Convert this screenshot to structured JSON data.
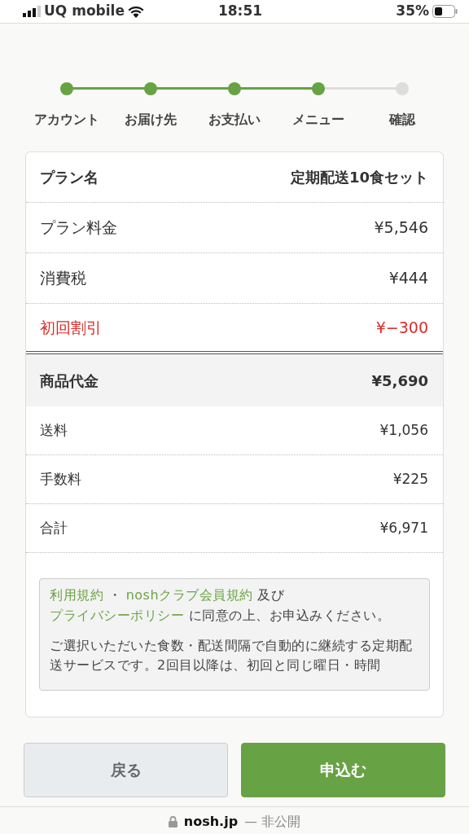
{
  "status_bar": {
    "carrier": "UQ mobile",
    "time": "18:51",
    "battery": "35%"
  },
  "steps": [
    {
      "label": "アカウント",
      "done": true
    },
    {
      "label": "お届け先",
      "done": true
    },
    {
      "label": "お支払い",
      "done": true
    },
    {
      "label": "メニュー",
      "done": true
    },
    {
      "label": "確認",
      "done": false
    }
  ],
  "summary": [
    {
      "kind": "header",
      "label": "プラン名",
      "value": "定期配送10食セット"
    },
    {
      "kind": "item",
      "label": "プラン料金",
      "value": "¥5,546"
    },
    {
      "kind": "item",
      "label": "消費税",
      "value": "¥444"
    },
    {
      "kind": "discount",
      "label": "初回割引",
      "value": "¥−300"
    },
    {
      "kind": "subtotal",
      "label": "商品代金",
      "value": "¥5,690"
    },
    {
      "kind": "small",
      "label": "送料",
      "value": "¥1,056"
    },
    {
      "kind": "small",
      "label": "手数料",
      "value": "¥225"
    },
    {
      "kind": "small",
      "label": "合計",
      "value": "¥6,971"
    }
  ],
  "agreement": {
    "parts": [
      {
        "text": "利用規約",
        "link": true
      },
      {
        "text": " ・ ",
        "link": false
      },
      {
        "text": "noshクラブ会員規約",
        "link": true
      },
      {
        "text": " 及び ",
        "link": false
      },
      {
        "text": "プライバシーポリシー",
        "link": true
      },
      {
        "text": " に同意の上、お申込みください。",
        "link": false
      }
    ],
    "note": "ご選択いただいた食数・配送間隔で自動的に継続する定期配送サービスです。2回目以降は、初回と同じ曜日・時間"
  },
  "buttons": [
    {
      "kind": "secondary",
      "label": "戻る"
    },
    {
      "kind": "primary",
      "label": "申込む"
    }
  ],
  "url_bar": {
    "domain": "nosh.jp",
    "note": "— 非公開"
  }
}
